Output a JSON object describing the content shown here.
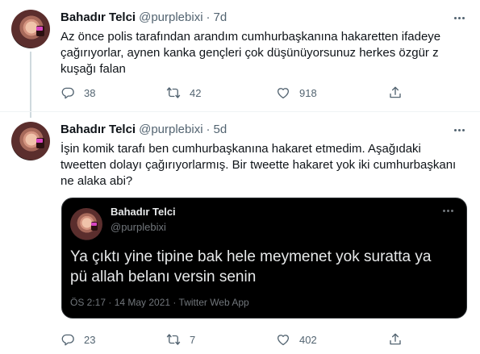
{
  "tweets": [
    {
      "author_name": "Bahadır Telci",
      "handle": "@purplebixi",
      "separator": "·",
      "time": "7d",
      "text_lines": [
        "Az önce polis tarafından arandım cumhurbaşkanına hakaretten ifadeye",
        "çağırıyorlar, aynen kanka gençleri çok düşünüyorsunuz herkes özgür z",
        "kuşağı falan"
      ],
      "reply_count": "38",
      "retweet_count": "42",
      "like_count": "918"
    },
    {
      "author_name": "Bahadır Telci",
      "handle": "@purplebixi",
      "separator": "·",
      "time": "5d",
      "text_lines": [
        "İşin komik tarafı ben cumhurbaşkanına hakaret etmedim. Aşağıdaki",
        "tweetten dolayı çağırıyorlarmış. Bir tweette hakaret yok iki cumhurbaşkanı",
        "ne alaka abi?"
      ],
      "reply_count": "23",
      "retweet_count": "7",
      "like_count": "402"
    }
  ],
  "quoted_tweet": {
    "author_name": "Bahadır Telci",
    "handle": "@purplebixi",
    "text_lines": [
      "Ya çıktı yine tipine bak hele meymenet yok suratta ya",
      "pü allah belanı versin senin"
    ],
    "meta": "ÖS 2:17 · 14 May 2021 · Twitter Web App"
  },
  "icons": {
    "reply": "reply-icon",
    "retweet": "retweet-icon",
    "like": "heart-icon",
    "share": "share-icon",
    "more": "more-options-icon"
  },
  "colors": {
    "text_primary": "#0f1419",
    "text_secondary": "#536471",
    "quote_background": "#000000",
    "thread_line": "#cfd9de"
  }
}
